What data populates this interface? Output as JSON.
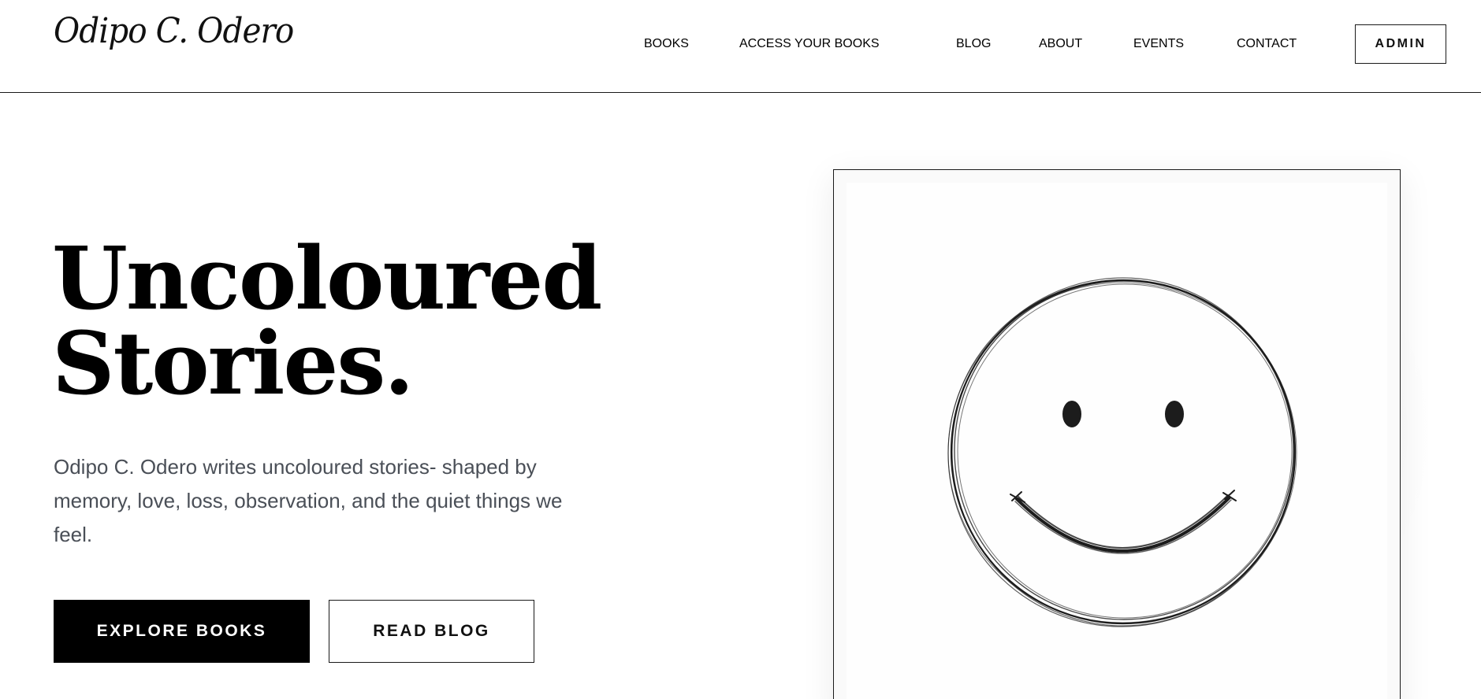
{
  "header": {
    "logo": "Odipo C. Odero",
    "nav": {
      "books": "BOOKS",
      "access": "ACCESS YOUR BOOKS",
      "blog": "BLOG",
      "about": "ABOUT",
      "events": "EVENTS",
      "contact": "CONTACT"
    },
    "admin_label": "ADMIN"
  },
  "hero": {
    "title_line1": "Uncoloured",
    "title_line2": "Stories.",
    "description": "Odipo C. Odero writes uncoloured stories- shaped by memory, love, loss, observation, and the quiet things we feel.",
    "primary_button": "EXPLORE BOOKS",
    "secondary_button": "READ BLOG"
  },
  "illustration": {
    "icon": "smiley-face-sketch"
  }
}
